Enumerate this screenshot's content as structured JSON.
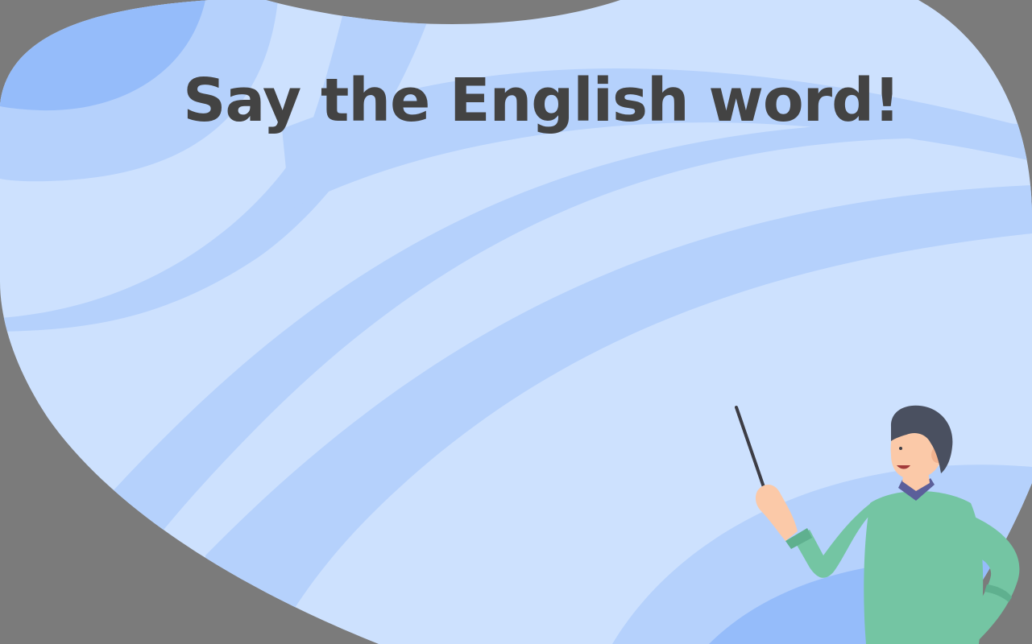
{
  "slide": {
    "title": "Say the English word!"
  },
  "colors": {
    "frame": "#7b7b7b",
    "blob_light": "#cde1fe",
    "blob_mid": "#b5d1fc",
    "blob_dark": "#95bcfa",
    "title_text": "#434343",
    "sweater": "#74c5a3",
    "hair": "#4a5060",
    "skin": "#fbc9a8",
    "collar": "#5b5f9a"
  },
  "illustration": {
    "figure": "teacher-with-pointer-icon"
  }
}
